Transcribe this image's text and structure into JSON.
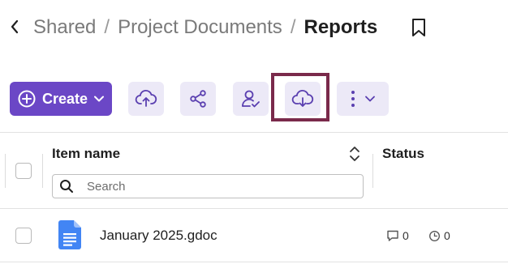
{
  "breadcrumb": {
    "items": [
      "Shared",
      "Project Documents"
    ],
    "separator": "/",
    "current": "Reports"
  },
  "toolbar": {
    "create_label": "Create",
    "buttons": [
      "upload-cloud-icon",
      "share-icon",
      "assign-user-icon",
      "download-cloud-icon",
      "more-vertical-icon"
    ],
    "accent_color": "#6b47c6",
    "button_bg": "#ece9f7",
    "highlight_color": "#7a2a4b"
  },
  "table": {
    "columns": {
      "item_name": "Item name",
      "status": "Status"
    },
    "search": {
      "placeholder": "Search",
      "value": ""
    },
    "rows": [
      {
        "name": "January 2025.gdoc",
        "comments": "0",
        "versions": "0",
        "icon": "gdoc-icon"
      }
    ]
  }
}
